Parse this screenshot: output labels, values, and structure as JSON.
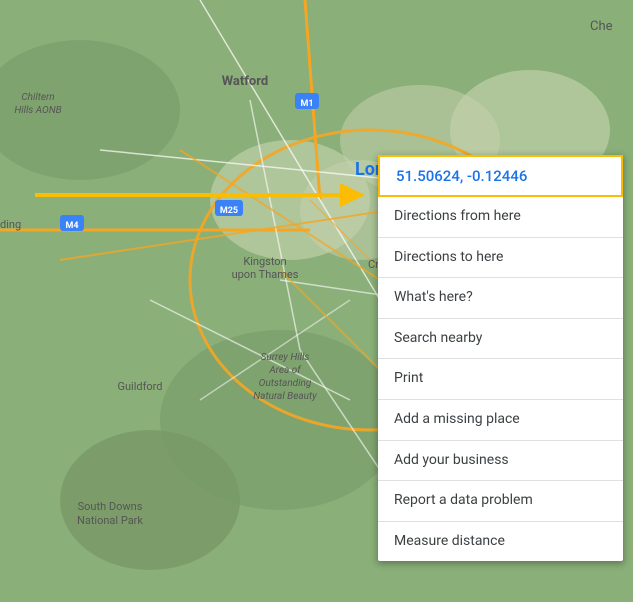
{
  "map": {
    "background_color": "#8aaf78",
    "arrow_label": "→"
  },
  "context_menu": {
    "coords": "51.50624, -0.12446",
    "items": [
      {
        "id": "directions-from",
        "label": "Directions from here"
      },
      {
        "id": "directions-to",
        "label": "Directions to here"
      },
      {
        "id": "whats-here",
        "label": "What's here?"
      },
      {
        "id": "search-nearby",
        "label": "Search nearby"
      },
      {
        "id": "print",
        "label": "Print"
      },
      {
        "id": "add-missing-place",
        "label": "Add a missing place"
      },
      {
        "id": "add-business",
        "label": "Add your business"
      },
      {
        "id": "report-data-problem",
        "label": "Report a data problem"
      },
      {
        "id": "measure-distance",
        "label": "Measure distance"
      }
    ]
  }
}
